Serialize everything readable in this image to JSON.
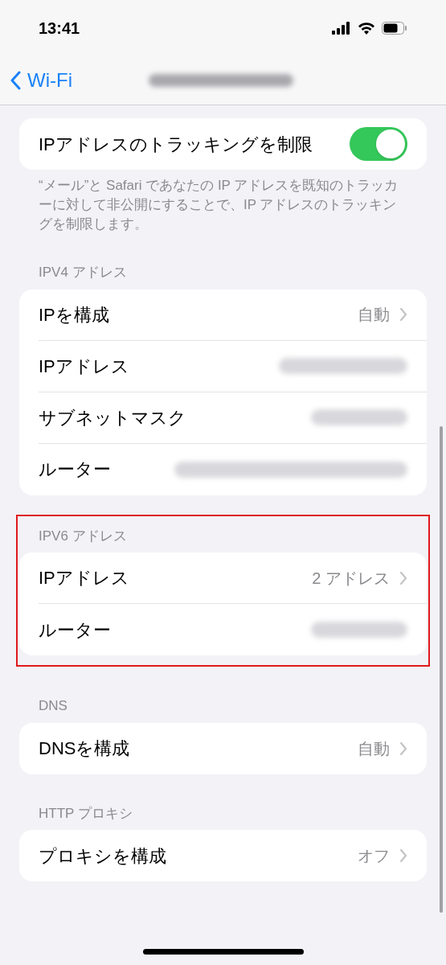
{
  "status_bar": {
    "time": "13:41"
  },
  "nav": {
    "back": "Wi-Fi"
  },
  "tracking": {
    "label": "IPアドレスのトラッキングを制限",
    "on": true,
    "footer": "“メール”と Safari であなたの IP アドレスを既知のトラッカーに対して非公開にすることで、IP アドレスのトラッキングを制限します。"
  },
  "sections": [
    {
      "header": "IPV4 アドレス",
      "highlighted": false,
      "rows": [
        {
          "kind": "detail",
          "label": "IPを構成",
          "value": "自動"
        },
        {
          "kind": "redacted",
          "label": "IPアドレス"
        },
        {
          "kind": "redacted",
          "label": "サブネットマスク"
        },
        {
          "kind": "redacted",
          "label": "ルーター"
        }
      ]
    },
    {
      "header": "IPV6 アドレス",
      "highlighted": true,
      "rows": [
        {
          "kind": "detail",
          "label": "IPアドレス",
          "value": "2 アドレス"
        },
        {
          "kind": "redacted",
          "label": "ルーター"
        }
      ]
    },
    {
      "header": "DNS",
      "highlighted": false,
      "rows": [
        {
          "kind": "detail",
          "label": "DNSを構成",
          "value": "自動"
        }
      ]
    },
    {
      "header": "HTTP プロキシ",
      "highlighted": false,
      "rows": [
        {
          "kind": "detail",
          "label": "プロキシを構成",
          "value": "オフ"
        }
      ]
    }
  ]
}
